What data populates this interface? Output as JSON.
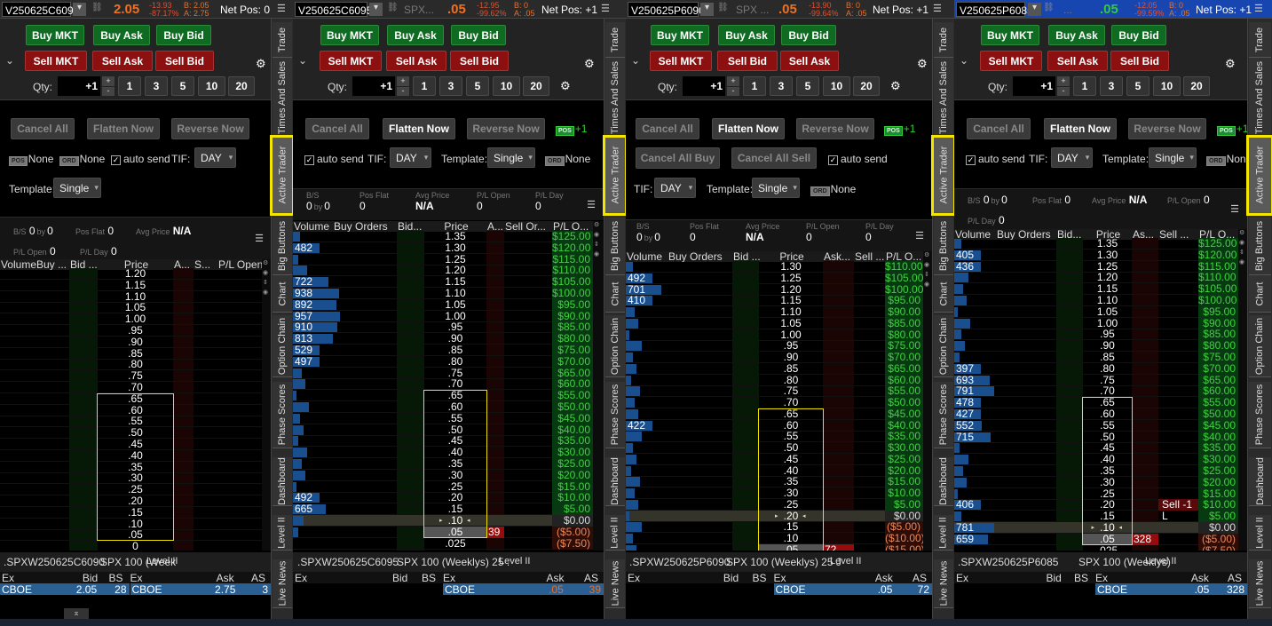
{
  "colors": {
    "buy": "#0e6b21",
    "sell": "#8c1010",
    "last_price_orange": "#f07020",
    "last_price_green": "#33cc33",
    "active_tab_outline": "#f5e600",
    "panel4_header": "#1846b0"
  },
  "side_tabs": [
    "Trade",
    "Times And Sales",
    "Active Trader",
    "Big Buttons",
    "Chart",
    "Option Chain",
    "Phase Scores",
    "Dashboard",
    "Level II",
    "Live News"
  ],
  "active_side_tab": "Active Trader",
  "panels": [
    {
      "header": {
        "symbol": "V250625C6090",
        "desc": "",
        "last": "2.05",
        "change": "-13.93",
        "change_pct": "-87.17%",
        "bid": "B: 2.05",
        "ask": "A: 2.75",
        "net_pos": "Net Pos: 0",
        "last_color": "#f07020"
      },
      "trade": {
        "buy_mkt": "Buy MKT",
        "buy_ask": "Buy Ask",
        "buy_bid": "Buy Bid",
        "sell_1": "Sell MKT",
        "sell_2": "Sell Ask",
        "sell_3": "Sell Bid",
        "qty_label": "Qty:",
        "qty": "+1",
        "plus": "+",
        "minus": "-",
        "presets": [
          "1",
          "3",
          "5",
          "10",
          "20"
        ]
      },
      "controls": {
        "cancel_all": "Cancel All",
        "flatten_now": "Flatten Now",
        "reverse_now": "Reverse Now",
        "flatten_enabled": false,
        "pos_label": "POS",
        "pos_value": "None",
        "ord_label": "ORD",
        "ord_value": "None",
        "auto_send": "auto send",
        "auto_send_checked": true,
        "tif_label": "TIF:",
        "tif_value": "DAY",
        "template_label": "Template:",
        "template_value": "Single"
      },
      "stats": {
        "bs_label": "B/S",
        "bs_buy": "0",
        "by": "by",
        "bs_sell": "0",
        "pos_flat_label": "Pos Flat",
        "pos_flat": "0",
        "avg_price_label": "Avg Price",
        "avg_price": "N/A",
        "pl_open_label": "P/L Open",
        "pl_open": "0",
        "pl_day_label": "P/L Day",
        "pl_day": "0"
      },
      "ladder": {
        "columns": [
          "Volume",
          "Buy ...",
          "Bid ...",
          "Price",
          "A...",
          "S...",
          "P/L Open"
        ],
        "last_trade_price": "",
        "highlight_range": [
          ".65",
          ".05"
        ],
        "rows": [
          [
            "1.20"
          ],
          [
            "1.15"
          ],
          [
            "1.10"
          ],
          [
            "1.05"
          ],
          [
            "1.00"
          ],
          [
            ".95"
          ],
          [
            ".90"
          ],
          [
            ".85"
          ],
          [
            ".80"
          ],
          [
            ".75"
          ],
          [
            ".70"
          ],
          [
            ".65"
          ],
          [
            ".60"
          ],
          [
            ".55"
          ],
          [
            ".50"
          ],
          [
            ".45"
          ],
          [
            ".40"
          ],
          [
            ".35"
          ],
          [
            ".30"
          ],
          [
            ".25"
          ],
          [
            ".20"
          ],
          [
            ".15"
          ],
          [
            ".10"
          ],
          [
            ".05"
          ],
          [
            "0"
          ]
        ]
      },
      "level2": {
        "tabs": [
          ".SPXW250625C6090",
          "SPX 100 (Week",
          "Level II"
        ],
        "columns": [
          "Ex",
          "Bid",
          "BS",
          "Ex",
          "Ask",
          "AS"
        ],
        "bid_row": [
          "CBOE",
          "2.05",
          "28"
        ],
        "ask_row": [
          "CBOE",
          "2.75",
          "3"
        ]
      }
    },
    {
      "header": {
        "symbol": "V250625C6095",
        "desc": "SPX...",
        "last": ".05",
        "change": "-12.95",
        "change_pct": "-99.62%",
        "bid": "B: 0",
        "ask": "A: .05",
        "net_pos": "Net Pos: +1",
        "last_color": "#f07020"
      },
      "trade": {
        "buy_mkt": "Buy MKT",
        "buy_ask": "Buy Ask",
        "buy_bid": "Buy Bid",
        "sell_1": "Sell MKT",
        "sell_2": "Sell Ask",
        "sell_3": "Sell Bid",
        "qty_label": "Qty:",
        "qty": "+1",
        "plus": "+",
        "minus": "-",
        "presets": [
          "1",
          "3",
          "5",
          "10",
          "20"
        ]
      },
      "controls": {
        "cancel_all": "Cancel All",
        "flatten_now": "Flatten Now",
        "reverse_now": "Reverse Now",
        "flatten_enabled": true,
        "pos_label": "POS",
        "pos_value": "+1",
        "ord_label": "ORD",
        "ord_value": "None",
        "auto_send": "auto send",
        "auto_send_checked": true,
        "tif_label": "TIF:",
        "tif_value": "DAY",
        "template_label": "Template:",
        "template_value": "Single"
      },
      "stats": {
        "bs_label": "B/S",
        "bs_buy": "0",
        "by": "by",
        "bs_sell": "0",
        "pos_flat_label": "Pos Flat",
        "pos_flat": "0",
        "avg_price_label": "Avg Price",
        "avg_price": "N/A",
        "pl_open_label": "P/L Open",
        "pl_open": "0",
        "pl_day_label": "P/L Day",
        "pl_day": "0"
      },
      "ladder": {
        "columns": [
          "Volume",
          "Buy Orders",
          "Bid...",
          "Price",
          "A...",
          "Sell Or...",
          "P/L O..."
        ],
        "last_trade_price": ".10",
        "highlight_range": [
          ".65",
          ".05"
        ],
        "rows": [
          [
            "1.35",
            "",
            "$125.00"
          ],
          [
            "1.30",
            "482",
            "$120.00"
          ],
          [
            "1.25",
            "",
            "$115.00"
          ],
          [
            "1.20",
            "",
            "$110.00"
          ],
          [
            "1.15",
            "722",
            "$105.00"
          ],
          [
            "1.10",
            "938",
            "$100.00"
          ],
          [
            "1.05",
            "892",
            "$95.00"
          ],
          [
            "1.00",
            "957",
            "$90.00"
          ],
          [
            ".95",
            "910",
            "$85.00"
          ],
          [
            ".90",
            "813",
            "$80.00"
          ],
          [
            ".85",
            "529",
            "$75.00"
          ],
          [
            ".80",
            "497",
            "$70.00"
          ],
          [
            ".75",
            "",
            "$65.00"
          ],
          [
            ".70",
            "",
            "$60.00"
          ],
          [
            ".65",
            "",
            "$55.00"
          ],
          [
            ".60",
            "",
            "$50.00"
          ],
          [
            ".55",
            "",
            "$45.00"
          ],
          [
            ".50",
            "",
            "$40.00"
          ],
          [
            ".45",
            "",
            "$35.00"
          ],
          [
            ".40",
            "",
            "$30.00"
          ],
          [
            ".35",
            "",
            "$25.00"
          ],
          [
            ".30",
            "",
            "$20.00"
          ],
          [
            ".25",
            "",
            "$15.00"
          ],
          [
            ".20",
            "492",
            "$10.00"
          ],
          [
            ".15",
            "665",
            "$5.00"
          ],
          [
            ".10",
            "",
            "$0.00"
          ],
          [
            ".05",
            "",
            "($5.00)",
            "39"
          ],
          [
            ".025",
            "",
            "($7.50)"
          ]
        ]
      },
      "level2": {
        "tabs": [
          ".SPXW250625C6095",
          "SPX 100 (Weeklys) 25 .",
          "Level II"
        ],
        "columns": [
          "Ex",
          "Bid",
          "BS",
          "Ex",
          "Ask",
          "AS"
        ],
        "bid_row": [],
        "ask_row": [
          "CBOE",
          ".05",
          "39"
        ]
      }
    },
    {
      "header": {
        "symbol": "V250625P6090",
        "desc": "SPX ...",
        "last": ".05",
        "change": "-13.90",
        "change_pct": "-99.64%",
        "bid": "B: 0",
        "ask": "A: .05",
        "net_pos": "Net Pos: +1",
        "last_color": "#f07020"
      },
      "trade": {
        "buy_mkt": "Buy MKT",
        "buy_ask": "Buy Ask",
        "buy_bid": "Buy Bid",
        "sell_1": "Sell MKT",
        "sell_2": "Sell Bid",
        "sell_3": "Sell Ask",
        "qty_label": "Qty:",
        "qty": "+1",
        "plus": "+",
        "minus": "-",
        "presets": [
          "1",
          "3",
          "5",
          "10",
          "20"
        ]
      },
      "controls": {
        "cancel_all": "Cancel All",
        "flatten_now": "Flatten Now",
        "reverse_now": "Reverse Now",
        "cancel_all_buy": "Cancel All Buy",
        "cancel_all_sell": "Cancel All Sell",
        "flatten_enabled": true,
        "pos_label": "POS",
        "pos_value": "+1",
        "ord_label": "ORD",
        "ord_value": "None",
        "auto_send": "auto send",
        "auto_send_checked": true,
        "tif_label": "TIF:",
        "tif_value": "DAY",
        "template_label": "Template:",
        "template_value": "Single"
      },
      "stats": {
        "bs_label": "B/S",
        "bs_buy": "0",
        "by": "by",
        "bs_sell": "0",
        "pos_flat_label": "Pos Flat",
        "pos_flat": "0",
        "avg_price_label": "Avg Price",
        "avg_price": "N/A",
        "pl_open_label": "P/L Open",
        "pl_open": "0",
        "pl_day_label": "P/L Day",
        "pl_day": "0"
      },
      "ladder": {
        "columns": [
          "Volume",
          "Buy Orders",
          "Bid ...",
          "Price",
          "Ask...",
          "Sell ...",
          "P/L O..."
        ],
        "last_trade_price": ".20",
        "highlight_range": [
          ".65",
          ".05"
        ],
        "rows": [
          [
            "1.30",
            "",
            "$110.00"
          ],
          [
            "1.25",
            "492",
            "$105.00"
          ],
          [
            "1.20",
            "701",
            "$100.00"
          ],
          [
            "1.15",
            "410",
            "$95.00"
          ],
          [
            "1.10",
            "",
            "$90.00"
          ],
          [
            "1.05",
            "",
            "$85.00"
          ],
          [
            "1.00",
            "",
            "$80.00"
          ],
          [
            ".95",
            "",
            "$75.00"
          ],
          [
            ".90",
            "",
            "$70.00"
          ],
          [
            ".85",
            "",
            "$65.00"
          ],
          [
            ".80",
            "",
            "$60.00"
          ],
          [
            ".75",
            "",
            "$55.00"
          ],
          [
            ".70",
            "",
            "$50.00"
          ],
          [
            ".65",
            "",
            "$45.00"
          ],
          [
            ".60",
            "422",
            "$40.00"
          ],
          [
            ".55",
            "",
            "$35.00"
          ],
          [
            ".50",
            "",
            "$30.00"
          ],
          [
            ".45",
            "",
            "$25.00"
          ],
          [
            ".40",
            "",
            "$20.00"
          ],
          [
            ".35",
            "",
            "$15.00"
          ],
          [
            ".30",
            "",
            "$10.00"
          ],
          [
            ".25",
            "",
            "$5.00"
          ],
          [
            ".20",
            "",
            "$0.00"
          ],
          [
            ".15",
            "",
            "($5.00)"
          ],
          [
            ".10",
            "",
            "($10.00)"
          ],
          [
            ".05",
            "",
            "($15.00)",
            "72"
          ]
        ]
      },
      "level2": {
        "tabs": [
          ".SPXW250625P6090",
          "SPX 100 (Weeklys) 25 J",
          "Level II"
        ],
        "columns": [
          "Ex",
          "Bid",
          "BS",
          "Ex",
          "Ask",
          "AS"
        ],
        "bid_row": [],
        "ask_row": [
          "CBOE",
          ".05",
          "72"
        ]
      }
    },
    {
      "header": {
        "symbol": "V250625P6085",
        "desc": "...",
        "last": ".05",
        "change": "-12.05",
        "change_pct": "-99.59%",
        "bid": "B: 0",
        "ask": "A: .05",
        "net_pos": "Net Pos: +1",
        "last_color": "#33cc33"
      },
      "trade": {
        "buy_mkt": "Buy MKT",
        "buy_ask": "Buy Ask",
        "buy_bid": "Buy Bid",
        "sell_1": "Sell MKT",
        "sell_2": "Sell Ask",
        "sell_3": "Sell Bid",
        "qty_label": "Qty:",
        "qty": "+1",
        "plus": "+",
        "minus": "-",
        "presets": [
          "1",
          "3",
          "5",
          "10",
          "20"
        ]
      },
      "controls": {
        "cancel_all": "Cancel All",
        "flatten_now": "Flatten Now",
        "reverse_now": "Reverse Now",
        "flatten_enabled": true,
        "pos_label": "POS",
        "pos_value": "+1",
        "ord_label": "ORD",
        "ord_value": "None",
        "auto_send": "auto send",
        "auto_send_checked": true,
        "tif_label": "TIF:",
        "tif_value": "DAY",
        "template_label": "Template:",
        "template_value": "Single"
      },
      "stats": {
        "bs_label": "B/S",
        "bs_buy": "0",
        "by": "by",
        "bs_sell": "0",
        "pos_flat_label": "Pos Flat",
        "pos_flat": "0",
        "avg_price_label": "Avg Price",
        "avg_price": "N/A",
        "pl_open_label": "P/L Open",
        "pl_open": "0",
        "pl_day_label": "P/L Day",
        "pl_day": "0"
      },
      "ladder": {
        "columns": [
          "Volume",
          "Buy Orders",
          "Bid...",
          "Price",
          "As...",
          "Sell ...",
          "P/L O..."
        ],
        "last_trade_price": ".10",
        "highlight_range": [
          ".65",
          ".05"
        ],
        "rows": [
          [
            "1.35",
            "",
            "$125.00"
          ],
          [
            "1.30",
            "405",
            "$120.00"
          ],
          [
            "1.25",
            "436",
            "$115.00"
          ],
          [
            "1.20",
            "",
            "$110.00"
          ],
          [
            "1.15",
            "",
            "$105.00"
          ],
          [
            "1.10",
            "",
            "$100.00"
          ],
          [
            "1.05",
            "",
            "$95.00"
          ],
          [
            "1.00",
            "",
            "$90.00"
          ],
          [
            ".95",
            "",
            "$85.00"
          ],
          [
            ".90",
            "",
            "$80.00"
          ],
          [
            ".85",
            "",
            "$75.00"
          ],
          [
            ".80",
            "397",
            "$70.00"
          ],
          [
            ".75",
            "693",
            "$65.00"
          ],
          [
            ".70",
            "791",
            "$60.00"
          ],
          [
            ".65",
            "478",
            "$55.00"
          ],
          [
            ".60",
            "427",
            "$50.00"
          ],
          [
            ".55",
            "552",
            "$45.00"
          ],
          [
            ".50",
            "715",
            "$40.00"
          ],
          [
            ".45",
            "",
            "$35.00"
          ],
          [
            ".40",
            "",
            "$30.00"
          ],
          [
            ".35",
            "",
            "$25.00"
          ],
          [
            ".30",
            "",
            "$20.00"
          ],
          [
            ".25",
            "",
            "$15.00"
          ],
          [
            ".20",
            "406",
            "$10.00",
            "",
            "Sell -1 L"
          ],
          [
            ".15",
            "",
            "$5.00"
          ],
          [
            ".10",
            "781",
            "$0.00"
          ],
          [
            ".05",
            "659",
            "($5.00)",
            "328"
          ],
          [
            ".025",
            "",
            "($7.50)"
          ]
        ]
      },
      "level2": {
        "tabs": [
          ".SPXW250625P6085",
          "SPX 100 (Weeklys)",
          "Level II"
        ],
        "columns": [
          "Ex",
          "Bid",
          "BS",
          "Ex",
          "Ask",
          "AS"
        ],
        "bid_row": [],
        "ask_row": [
          "CBOE",
          ".05",
          "328"
        ]
      }
    }
  ]
}
